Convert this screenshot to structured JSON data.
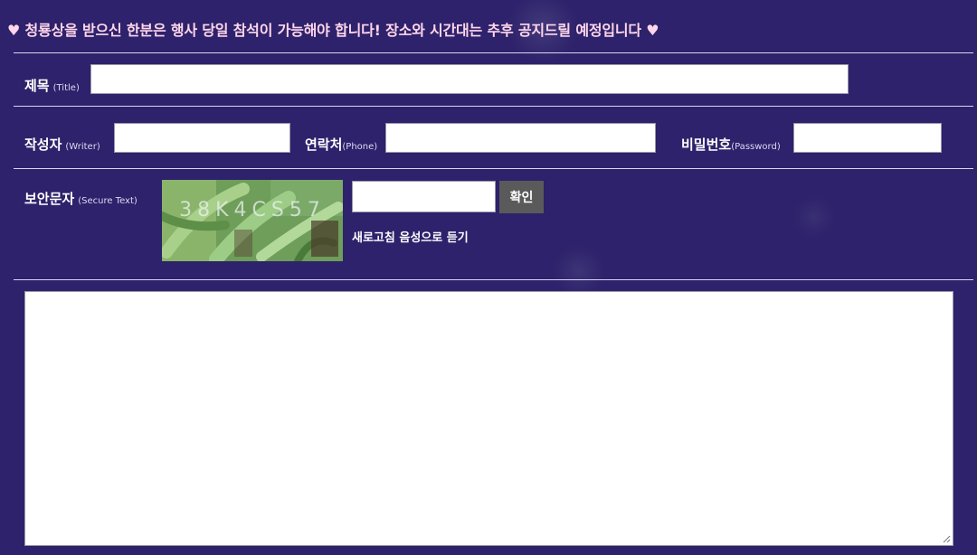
{
  "notice": {
    "heart": "♥",
    "text": "청룡상을 받으신 한분은 행사 당일 참석이 가능해야 합니다! 장소와 시간대는 추후 공지드릴 예정입니다"
  },
  "form": {
    "title": {
      "label": "제목",
      "sub": "(Title)",
      "value": ""
    },
    "writer": {
      "label": "작성자",
      "sub": "(Writer)",
      "value": ""
    },
    "phone": {
      "label": "연락처",
      "sub": "(Phone)",
      "value": ""
    },
    "password": {
      "label": "비밀번호",
      "sub": "(Password)",
      "value": ""
    },
    "secure": {
      "label": "보안문자",
      "sub": "(Secure Text)",
      "captcha_text": "38K4CS57",
      "value": "",
      "confirm_label": "확인",
      "refresh_label": "새로고침",
      "audio_label": "음성으로 듣기"
    },
    "content": {
      "value": ""
    }
  },
  "colors": {
    "background": "#2d226b",
    "notice_text": "#ffd6ea",
    "divider": "#d9d4ee",
    "confirm_button": "#5a5a5a"
  }
}
